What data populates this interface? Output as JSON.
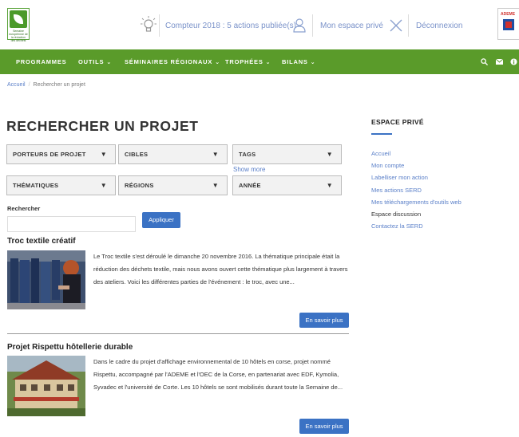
{
  "header": {
    "logo_text": "Semaine européenne de la réduction des déchets",
    "counter": "Compteur 2018 : 5 actions publiée(s)",
    "private_space": "Mon espace privé",
    "logout": "Déconnexion",
    "partner_logo_text": "ADEME"
  },
  "nav": {
    "items": [
      {
        "label": "PROGRAMMES",
        "has_dropdown": false
      },
      {
        "label": "OUTILS",
        "has_dropdown": true
      },
      {
        "label": "SÉMINAIRES RÉGIONAUX",
        "has_dropdown": true
      },
      {
        "label": "TROPHÉES",
        "has_dropdown": true
      },
      {
        "label": "BILANS",
        "has_dropdown": true
      }
    ],
    "icons": [
      "search-icon",
      "envelope-icon",
      "info-icon"
    ]
  },
  "breadcrumb": {
    "home": "Accueil",
    "current": "Rechercher un projet"
  },
  "page_title": "RECHERCHER UN PROJET",
  "filters": {
    "porteurs": "PORTEURS DE PROJET",
    "cibles": "CIBLES",
    "tags": "TAGS",
    "show_more": "Show more",
    "thematiques": "THÉMATIQUES",
    "regions": "RÉGIONS",
    "annee": "ANNÉE"
  },
  "search": {
    "label": "Rechercher",
    "value": "",
    "button": "Appliquer"
  },
  "results": [
    {
      "title": "Troc textile créatif",
      "text": "Le Troc textile s'est déroulé le dimanche 20 novembre 2016. La thématique principale était la réduction des déchets textile, mais nous avons ouvert cette thématique plus largement à travers des ateliers. Voici les différentes parties de l'événement :   le troc, avec une...",
      "more": "En savoir plus"
    },
    {
      "title": "Projet Rispettu hôtellerie durable",
      "text": "Dans le cadre du projet d'affichage environnemental de 10 hôtels en corse, projet nommé Rispettu, accompagné par l'ADEME et l'OEC de la Corse, en partenariat avec EDF, Kymolia, Syvadec et l'université de Corte. Les 10 hôtels se sont mobilisés durant toute la Semaine de...",
      "more": "En savoir plus"
    }
  ],
  "sidebar": {
    "title": "ESPACE PRIVÉ",
    "links": [
      "Accueil",
      "Mon compte",
      "Labelliser mon action",
      "Mes actions SERD",
      "Mes téléchargements d'outils web",
      "Espace discussion",
      "Contactez la SERD"
    ]
  },
  "colors": {
    "nav_green": "#5a9b2a",
    "accent_blue": "#3b72c4",
    "link_blue": "#5a7fc8"
  }
}
